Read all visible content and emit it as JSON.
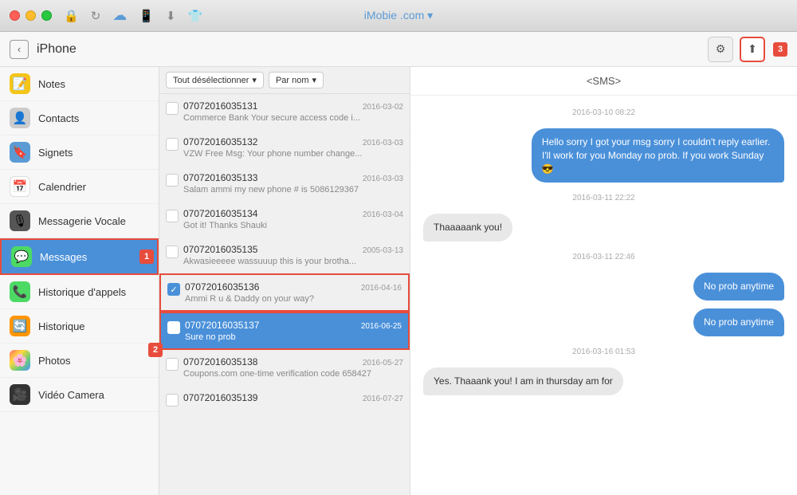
{
  "titlebar": {
    "title": "iMobie",
    "title_suffix": " .com",
    "dropdown_indicator": "▾"
  },
  "navbar": {
    "back_label": "‹",
    "title": "iPhone",
    "settings_icon": "⚙",
    "export_icon": "⬆"
  },
  "sidebar": {
    "items": [
      {
        "id": "notes",
        "label": "Notes",
        "icon": "📝",
        "active": false
      },
      {
        "id": "contacts",
        "label": "Contacts",
        "icon": "👤",
        "active": false
      },
      {
        "id": "signets",
        "label": "Signets",
        "icon": "🔵",
        "active": false
      },
      {
        "id": "calendrier",
        "label": "Calendrier",
        "icon": "📅",
        "active": false
      },
      {
        "id": "messagerie",
        "label": "Messagerie Vocale",
        "icon": "🎙",
        "active": false
      },
      {
        "id": "messages",
        "label": "Messages",
        "icon": "💬",
        "active": true
      },
      {
        "id": "historique-appels",
        "label": "Historique d'appels",
        "icon": "📞",
        "active": false
      },
      {
        "id": "historique",
        "label": "Historique",
        "icon": "🔄",
        "active": false
      },
      {
        "id": "photos",
        "label": "Photos",
        "icon": "🌸",
        "active": false
      },
      {
        "id": "video",
        "label": "Vidéo Camera",
        "icon": "🎥",
        "active": false
      }
    ]
  },
  "message_list": {
    "deselect_all": "Tout désélectionner",
    "sort_by": "Par nom",
    "items": [
      {
        "number": "07072016035131",
        "date": "2016-03-02",
        "preview": "Commerce Bank Your secure access code i...",
        "checked": false,
        "selected": false
      },
      {
        "number": "07072016035132",
        "date": "2016-03-03",
        "preview": "VZW Free Msg: Your phone number change...",
        "checked": false,
        "selected": false
      },
      {
        "number": "07072016035133",
        "date": "2016-03-03",
        "preview": "Salam ammi my new phone # is 5086129367",
        "checked": false,
        "selected": false
      },
      {
        "number": "07072016035134",
        "date": "2016-03-04",
        "preview": "Got it! Thanks Shauki",
        "checked": false,
        "selected": false
      },
      {
        "number": "07072016035135",
        "date": "2005-03-13",
        "preview": "Akwasieeeee wassuuup this is your brotha...",
        "checked": false,
        "selected": false
      },
      {
        "number": "07072016035136",
        "date": "2016-04-16",
        "preview": "Ammi R u & Daddy on your way?",
        "checked": true,
        "selected": false
      },
      {
        "number": "07072016035137",
        "date": "2016-06-25",
        "preview": "Sure no prob",
        "checked": true,
        "selected": true
      },
      {
        "number": "07072016035138",
        "date": "2016-05-27",
        "preview": "Coupons.com one-time verification code 658427",
        "checked": false,
        "selected": false
      },
      {
        "number": "07072016035139",
        "date": "2016-07-27",
        "preview": "",
        "checked": false,
        "selected": false
      }
    ]
  },
  "chat": {
    "contact": "<SMS>",
    "messages": [
      {
        "type": "date",
        "text": "2016-03-10 08:22"
      },
      {
        "type": "sent",
        "text": "Hello sorry I got your msg sorry I couldn't reply earlier. I'll work for you Monday no prob. If you work Sunday 😎"
      },
      {
        "type": "date",
        "text": "2016-03-11 22:22"
      },
      {
        "type": "received",
        "text": "Thaaaaank you!"
      },
      {
        "type": "date",
        "text": "2016-03-11 22:46"
      },
      {
        "type": "sent",
        "text": "No prob anytime"
      },
      {
        "type": "sent",
        "text": "No prob anytime"
      },
      {
        "type": "date",
        "text": "2016-03-16 01:53"
      },
      {
        "type": "received",
        "text": "Yes.  Thaaank you! I am in thursday am for"
      }
    ]
  },
  "badges": {
    "step1": "1",
    "step2": "2",
    "step3": "3"
  }
}
